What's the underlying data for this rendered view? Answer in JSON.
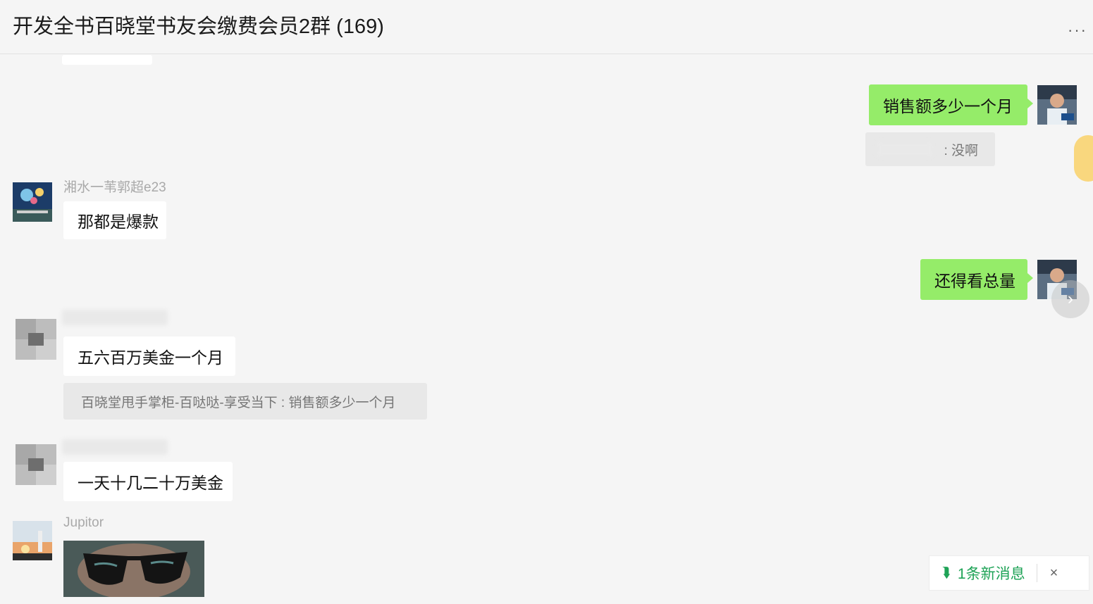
{
  "header": {
    "title": "开发全书百晓堂书友会缴费会员2群 (169)",
    "more_label": "···"
  },
  "messages": [
    {
      "side": "right",
      "text": "销售额多少一个月"
    },
    {
      "side": "right",
      "quote": ": 没啊"
    },
    {
      "side": "left",
      "sender": "湘水一苇郭超e23",
      "text": "那都是爆款"
    },
    {
      "side": "right",
      "text": "还得看总量"
    },
    {
      "side": "left",
      "text": "五六百万美金一个月",
      "quote": "百晓堂甩手掌柜-百哒哒-享受当下 : 销售额多少一个月"
    },
    {
      "side": "left",
      "text": "一天十几二十万美金"
    },
    {
      "side": "left",
      "sender": "Jupitor",
      "image": "sunglasses-photo"
    }
  ],
  "new_message_notice": {
    "arrow_icon": "double-chevron-down-icon",
    "label": "1条新消息",
    "close": "×"
  },
  "scroll_button": {
    "icon": "chevron-right-icon",
    "glyph": "›"
  },
  "colors": {
    "out_bubble": "#95ec69",
    "in_bubble": "#ffffff",
    "accent": "#1fa357",
    "background": "#f5f5f5"
  }
}
